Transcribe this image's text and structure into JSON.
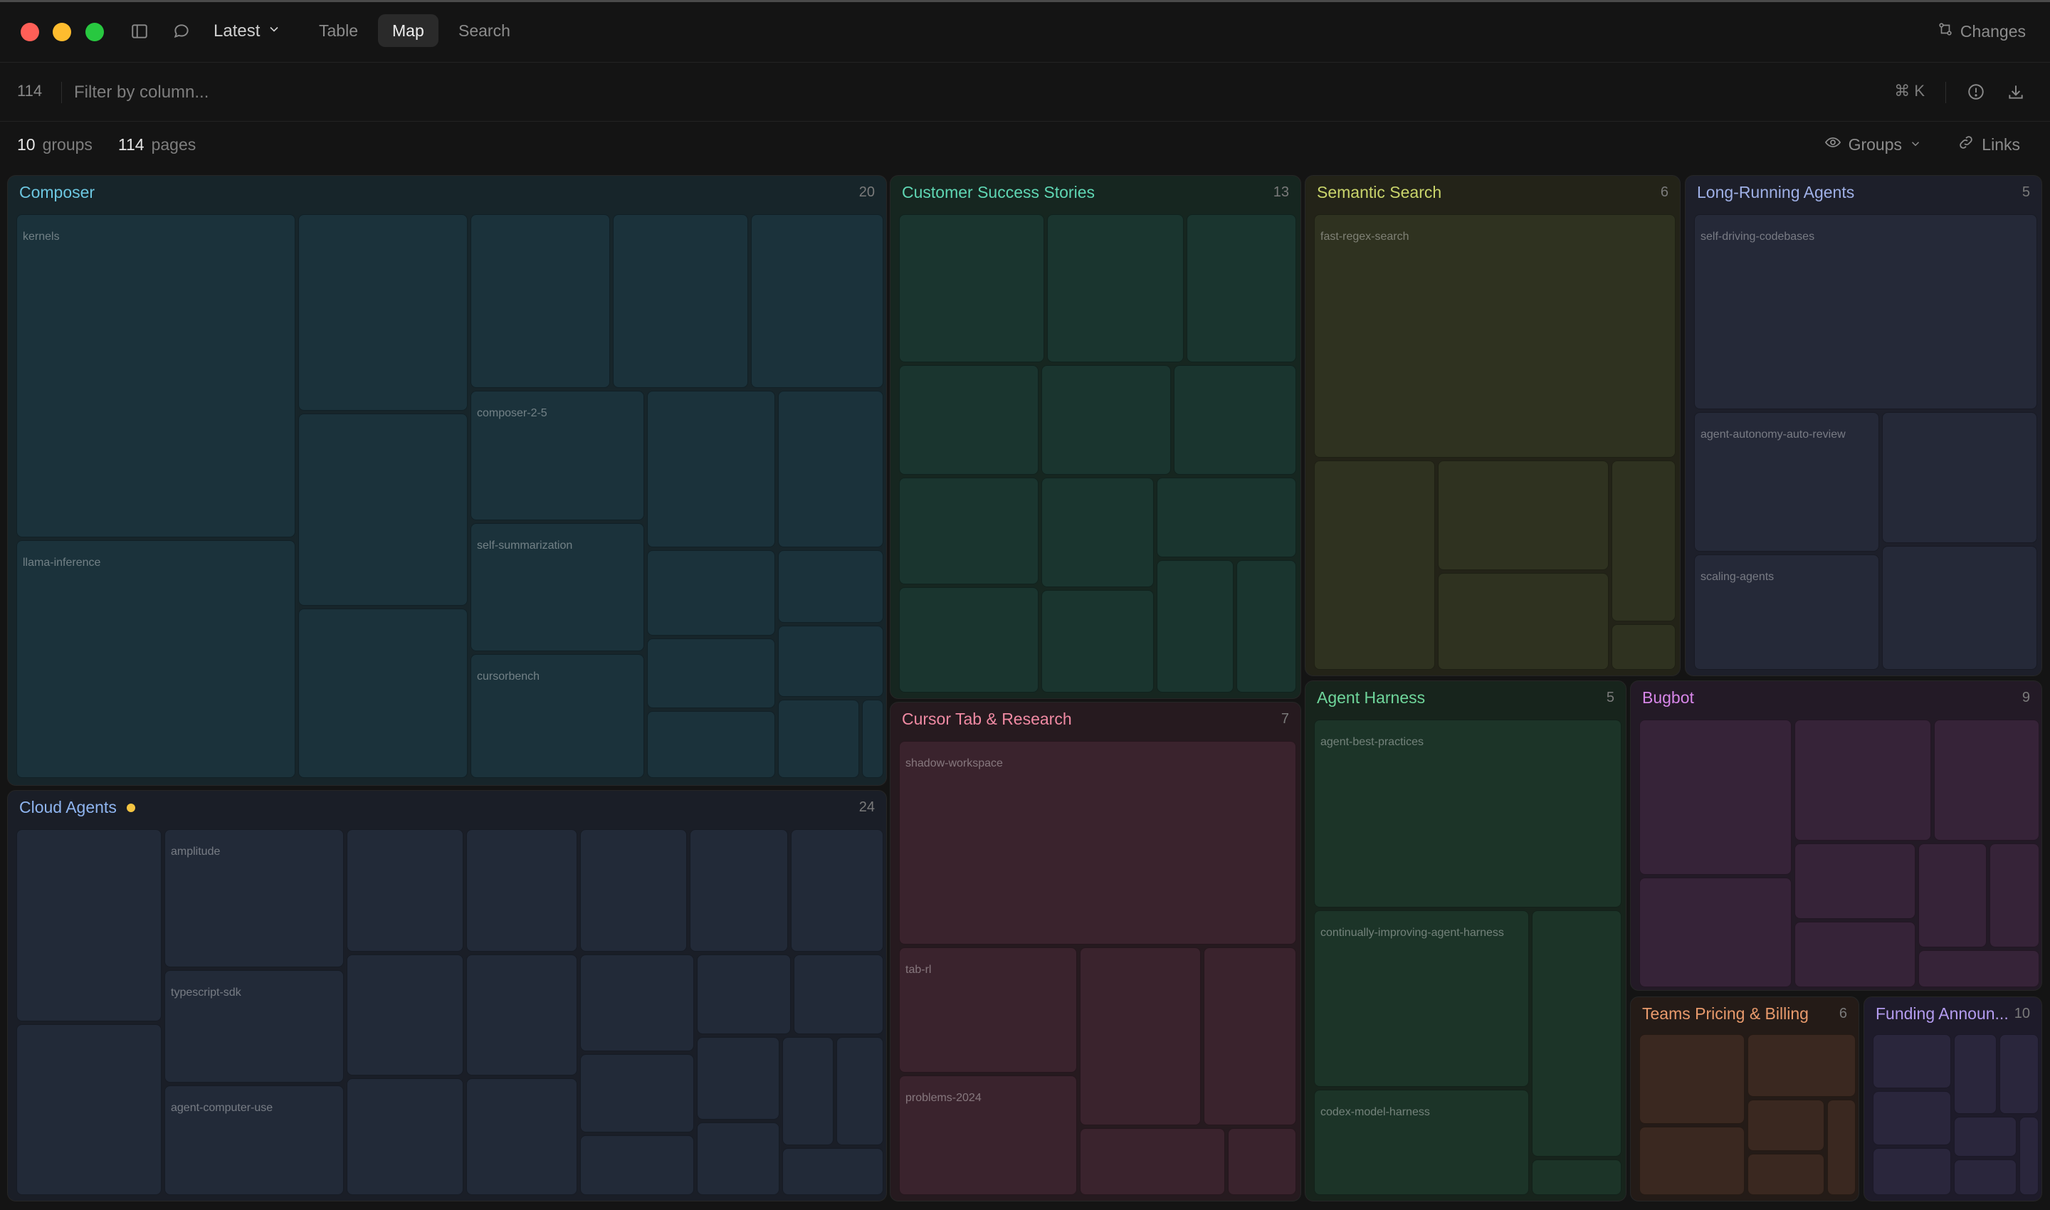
{
  "window": {
    "version_selector": "Latest",
    "tabs": [
      {
        "label": "Table",
        "active": false
      },
      {
        "label": "Map",
        "active": true
      },
      {
        "label": "Search",
        "active": false
      }
    ],
    "changes_label": "Changes"
  },
  "filter": {
    "count": "114",
    "placeholder": "Filter by column...",
    "shortcut": "⌘ K"
  },
  "stats": {
    "groups_count": "10",
    "groups_label": "groups",
    "pages_count": "114",
    "pages_label": "pages",
    "groups_button": "Groups",
    "links_button": "Links"
  },
  "groups": {
    "composer": {
      "title": "Composer",
      "count": "20",
      "labels": [
        "kernels",
        "llama-inference",
        "composer-2-5",
        "self-summarization",
        "cursorbench"
      ]
    },
    "customer_success": {
      "title": "Customer Success Stories",
      "count": "13"
    },
    "semantic_search": {
      "title": "Semantic Search",
      "count": "6",
      "labels": [
        "fast-regex-search"
      ]
    },
    "long_running": {
      "title": "Long-Running Agents",
      "count": "5",
      "labels": [
        "self-driving-codebases",
        "agent-autonomy-auto-review",
        "scaling-agents"
      ]
    },
    "cloud_agents": {
      "title": "Cloud Agents",
      "count": "24",
      "labels": [
        "amplitude",
        "typescript-sdk",
        "agent-computer-use"
      ]
    },
    "cursor_tab": {
      "title": "Cursor Tab & Research",
      "count": "7",
      "labels": [
        "shadow-workspace",
        "tab-rl",
        "problems-2024"
      ]
    },
    "agent_harness": {
      "title": "Agent Harness",
      "count": "5",
      "labels": [
        "agent-best-practices",
        "continually-improving-agent-harness",
        "codex-model-harness"
      ]
    },
    "bugbot": {
      "title": "Bugbot",
      "count": "9"
    },
    "teams_pricing": {
      "title": "Teams Pricing & Billing",
      "count": "6"
    },
    "funding": {
      "title": "Funding Announ...",
      "count": "10"
    }
  },
  "colors": {
    "composer": "#6cc6e0",
    "customer_success": "#5fd6b3",
    "semantic_search": "#c9d46b",
    "long_running": "#9fb0e6",
    "cloud_agents": "#8fb5f0",
    "cursor_tab": "#f08aa3",
    "agent_harness": "#6fd69b",
    "bugbot": "#d786e8",
    "teams_pricing": "#e89a6c",
    "funding": "#b49cf0",
    "active_dot": "#f5c542"
  },
  "icons": [
    "sidebar-toggle-icon",
    "chat-bubble-icon",
    "chevron-down-icon",
    "changes-icon",
    "info-icon",
    "download-icon",
    "eye-icon",
    "link-icon"
  ]
}
